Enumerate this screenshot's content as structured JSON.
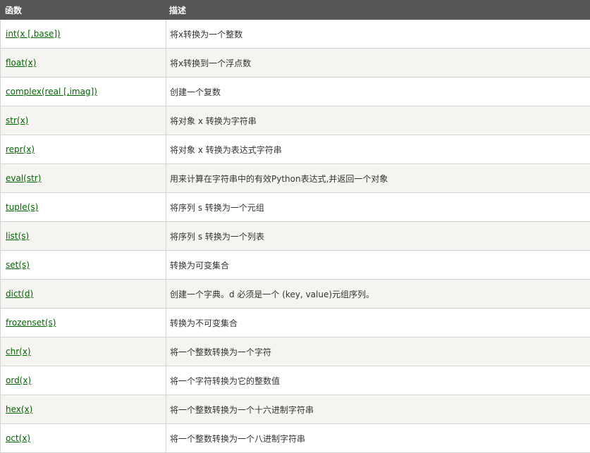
{
  "header": {
    "col_function": "函数",
    "col_description": "描述"
  },
  "colors": {
    "header_bg": "#555555",
    "link": "#006600",
    "row_alt": "#f6f4f0",
    "border": "#d4d4d4"
  },
  "rows": [
    {
      "func": "int(x [,base])",
      "desc": "将x转换为一个整数"
    },
    {
      "func": "float(x)",
      "desc": "将x转换到一个浮点数"
    },
    {
      "func": "complex(real [,imag])",
      "desc": "创建一个复数"
    },
    {
      "func": "str(x)",
      "desc": "将对象 x 转换为字符串"
    },
    {
      "func": "repr(x)",
      "desc": "将对象 x 转换为表达式字符串"
    },
    {
      "func": "eval(str)",
      "desc": "用来计算在字符串中的有效Python表达式,并返回一个对象"
    },
    {
      "func": "tuple(s)",
      "desc": "将序列 s 转换为一个元组"
    },
    {
      "func": "list(s)",
      "desc": "将序列 s 转换为一个列表"
    },
    {
      "func": "set(s)",
      "desc": "转换为可变集合"
    },
    {
      "func": "dict(d)",
      "desc": "创建一个字典。d 必须是一个 (key, value)元组序列。"
    },
    {
      "func": "frozenset(s)",
      "desc": "转换为不可变集合"
    },
    {
      "func": "chr(x)",
      "desc": "将一个整数转换为一个字符"
    },
    {
      "func": "ord(x)",
      "desc": "将一个字符转换为它的整数值"
    },
    {
      "func": "hex(x)",
      "desc": "将一个整数转换为一个十六进制字符串"
    },
    {
      "func": "oct(x)",
      "desc": "将一个整数转换为一个八进制字符串"
    }
  ]
}
